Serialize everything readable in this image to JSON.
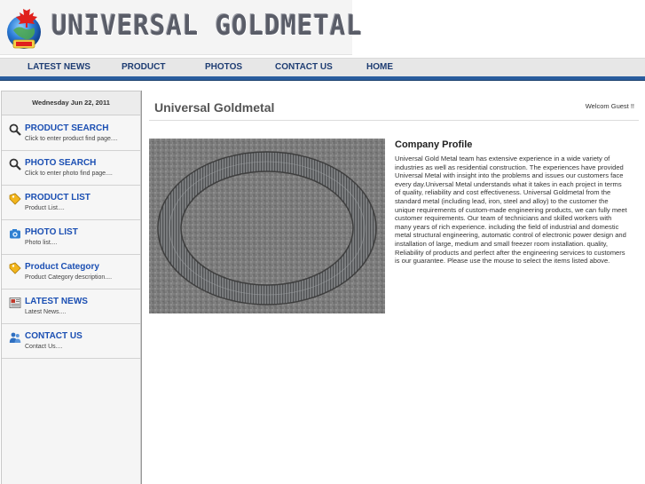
{
  "header": {
    "brand": "UNIVERSAL GOLDMETAL",
    "logo_icon": "maple-leaf-globe-icon"
  },
  "nav": {
    "items": [
      {
        "label": "LATEST NEWS"
      },
      {
        "label": "PRODUCT"
      },
      {
        "label": "PHOTOS"
      },
      {
        "label": "CONTACT US"
      },
      {
        "label": "HOME"
      }
    ]
  },
  "sidebar": {
    "date": "Wednesday  Jun 22, 2011",
    "items": [
      {
        "title": "PRODUCT SEARCH",
        "sub": "Click to enter product find page....",
        "icon": "magnifier-icon"
      },
      {
        "title": "PHOTO SEARCH",
        "sub": "Click to enter photo find page....",
        "icon": "magnifier-icon"
      },
      {
        "title": "PRODUCT LIST",
        "sub": "Product List....",
        "icon": "tag-icon"
      },
      {
        "title": "PHOTO LIST",
        "sub": "Photo list....",
        "icon": "camera-icon"
      },
      {
        "title": "Product Category",
        "sub": "Product Category description....",
        "icon": "tag-icon"
      },
      {
        "title": "LATEST NEWS",
        "sub": "Latest News....",
        "icon": "newspaper-icon"
      },
      {
        "title": "CONTACT US",
        "sub": "Contact Us....",
        "icon": "people-icon"
      }
    ]
  },
  "main": {
    "title": "Universal Goldmetal",
    "welcome": "Welcom Guest !!",
    "profile_heading": "Company Profile",
    "profile_body": "Universal Gold Metal team has extensive experience in a wide variety of industries as well as residential construction. The experiences have provided Universal Metal with insight into the problems and issues our customers face every day.Universal Metal understands what it takes in each project in terms of quality, reliability and cost effectiveness. Universal Goldmetal from the standard metal (including lead, iron, steel and alloy) to the customer the unique requirements of custom-made engineering products, we can fully meet customer requirements. Our team of technicians and skilled workers with many years of rich experience. including the field of industrial and domestic metal structural engineering, automatic control of electronic power design and installation of large, medium and small freezer room installation. quality, Reliability of products and perfect after the engineering services to customers is our guarantee. Please use the mouse to select the items listed above."
  },
  "colors": {
    "nav_text": "#1e3d73",
    "accent_bar": "#2a5d9e",
    "sidebar_link": "#1b4fb3"
  }
}
